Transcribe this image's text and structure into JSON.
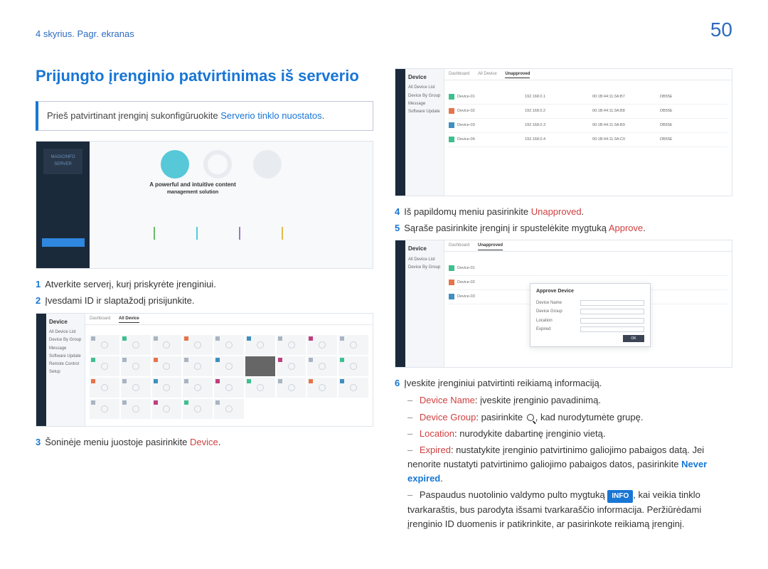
{
  "chapter": "4 skyrius. Pagr. ekranas",
  "page_number": "50",
  "section_title": "Prijungto įrenginio patvirtinimas iš serverio",
  "note": {
    "before": "Prieš patvirtinant įrenginį sukonfigūruokite ",
    "link": "Serverio tinklo nuostatos",
    "after": "."
  },
  "login_screenshot": {
    "logo_text": "MAGICINFO SERVER",
    "headline1": "A powerful and intuitive content",
    "headline2": "management solution"
  },
  "device_nav": {
    "title": "Device",
    "items": [
      "All Device List",
      "Device By Group",
      "Message",
      "Software Update",
      "Remote Control",
      "Setup"
    ],
    "tabs": {
      "dashboard": "Dashboard",
      "all_device": "All Device",
      "unapproved": "Unapproved"
    }
  },
  "unapproved_table": {
    "rows": [
      {
        "name": "Device-01",
        "ip": "192.168.0.1",
        "mac": "00:1B:44:11:3A:B7",
        "model": "DB55E"
      },
      {
        "name": "Device-02",
        "ip": "192.168.0.2",
        "mac": "00:1B:44:11:3A:B8",
        "model": "DB55E"
      },
      {
        "name": "Device-03",
        "ip": "192.168.0.3",
        "mac": "00:1B:44:11:3A:B9",
        "model": "DB55E"
      },
      {
        "name": "Device-04",
        "ip": "192.168.0.4",
        "mac": "00:1B:44:11:3A:C0",
        "model": "DB55E"
      }
    ]
  },
  "approve_dialog": {
    "title": "Approve Device",
    "fields": {
      "name": "Device Name",
      "group": "Device Group",
      "location": "Location",
      "expired": "Expired"
    },
    "ok": "OK"
  },
  "steps_left": {
    "s1": {
      "n": "1",
      "text": "Atverkite serverį, kurį priskyrėte įrenginiui."
    },
    "s2": {
      "n": "2",
      "text": "Įvesdami ID ir slaptažodį prisijunkite."
    },
    "s3": {
      "n": "3",
      "before": "Šoninėje meniu juostoje pasirinkite ",
      "kw": "Device",
      "after": "."
    }
  },
  "steps_right": {
    "s4": {
      "n": "4",
      "before": "Iš papildomų meniu pasirinkite ",
      "kw": "Unapproved",
      "after": "."
    },
    "s5": {
      "n": "5",
      "before": "Sąraše pasirinkite įrenginį ir spustelėkite mygtuką ",
      "kw": "Approve",
      "after": "."
    },
    "s6": {
      "n": "6",
      "text": "Įveskite įrenginiui patvirtinti reikiamą informaciją."
    }
  },
  "sub_items": {
    "a": {
      "kw": "Device Name",
      "text": ": įveskite įrenginio pavadinimą."
    },
    "b": {
      "kw": "Device Group",
      "before": ": pasirinkite ",
      "after": ", kad nurodytumėte grupę."
    },
    "c": {
      "kw": "Location",
      "text": ": nurodykite dabartinę įrenginio vietą."
    },
    "d": {
      "kw": "Expired",
      "text": ": nustatykite įrenginio patvirtinimo galiojimo pabaigos datą. Jei nenorite nustatyti patvirtinimo galiojimo pabaigos datos, pasirinkite ",
      "kw2": "Never expired",
      "after": "."
    },
    "e": {
      "before": "Paspaudus nuotolinio valdymo pulto mygtuką ",
      "badge": "INFO",
      "after": ", kai veikia tinklo tvarkaraštis, bus parodyta išsami tvarkaraščio informacija. Peržiūrėdami įrenginio ID duomenis ir patikrinkite, ar pasirinkote reikiamą įrenginį."
    }
  }
}
